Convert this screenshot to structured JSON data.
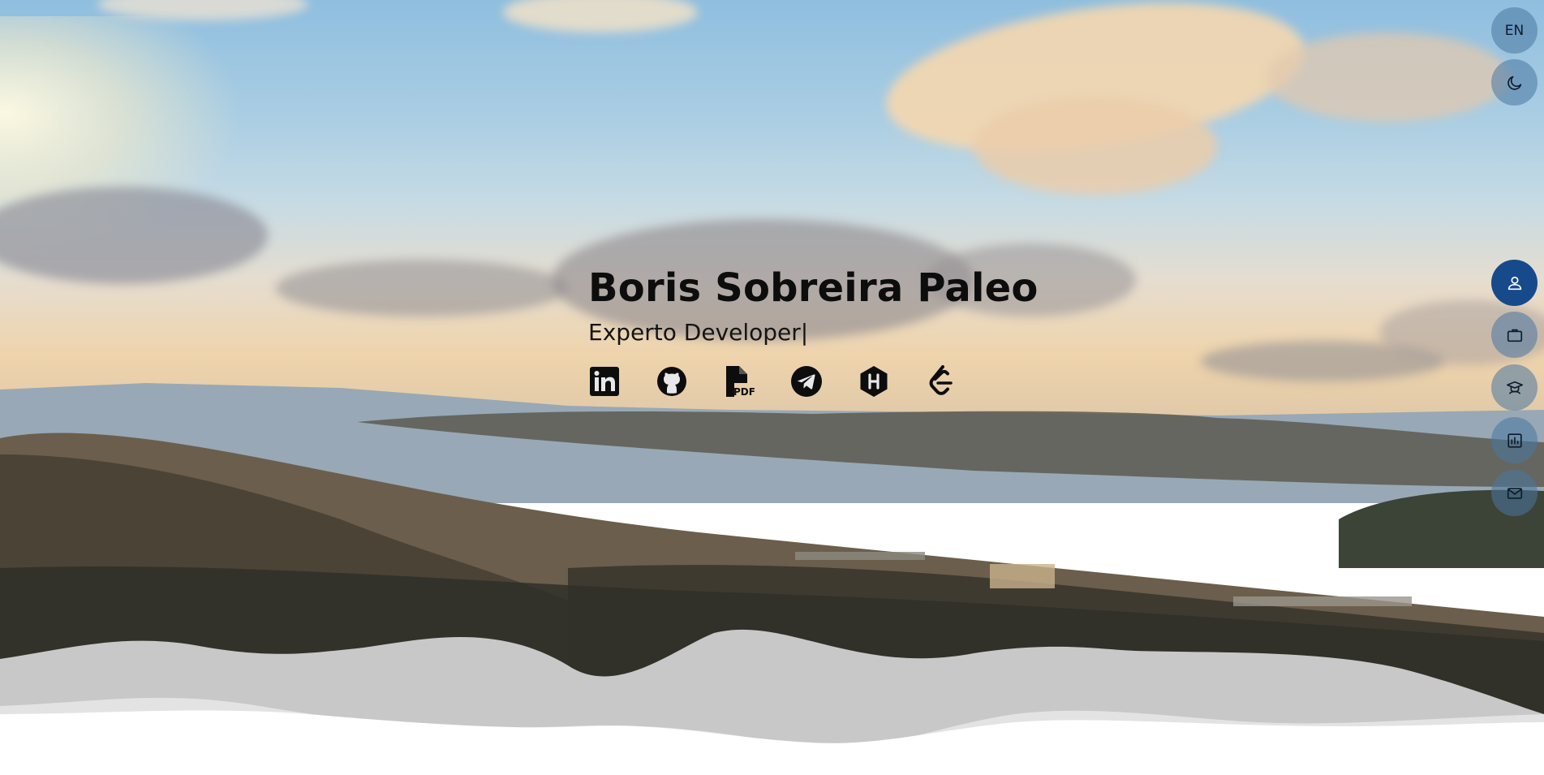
{
  "top_controls": {
    "language_label": "EN",
    "theme_icon": "moon-icon"
  },
  "hero": {
    "name": "Boris Sobreira Paleo",
    "tagline": "Experto Developer",
    "cursor": "|"
  },
  "socials": [
    {
      "name": "linkedin-icon"
    },
    {
      "name": "github-icon"
    },
    {
      "name": "pdf-file-icon",
      "badge": "PDF"
    },
    {
      "name": "telegram-icon"
    },
    {
      "name": "hashnode-icon"
    },
    {
      "name": "leetcode-icon"
    }
  ],
  "side_nav": [
    {
      "name": "person-icon",
      "active": true
    },
    {
      "name": "briefcase-icon",
      "active": false
    },
    {
      "name": "graduation-icon",
      "active": false
    },
    {
      "name": "bar-chart-icon",
      "active": false
    },
    {
      "name": "mail-icon",
      "active": false
    }
  ],
  "colors": {
    "accent": "#174a8a",
    "fab_inactive": "#4977a0",
    "text": "#0d0d0d",
    "wave_dark": "#c8c8c8",
    "wave_light": "#e5e5e5"
  }
}
